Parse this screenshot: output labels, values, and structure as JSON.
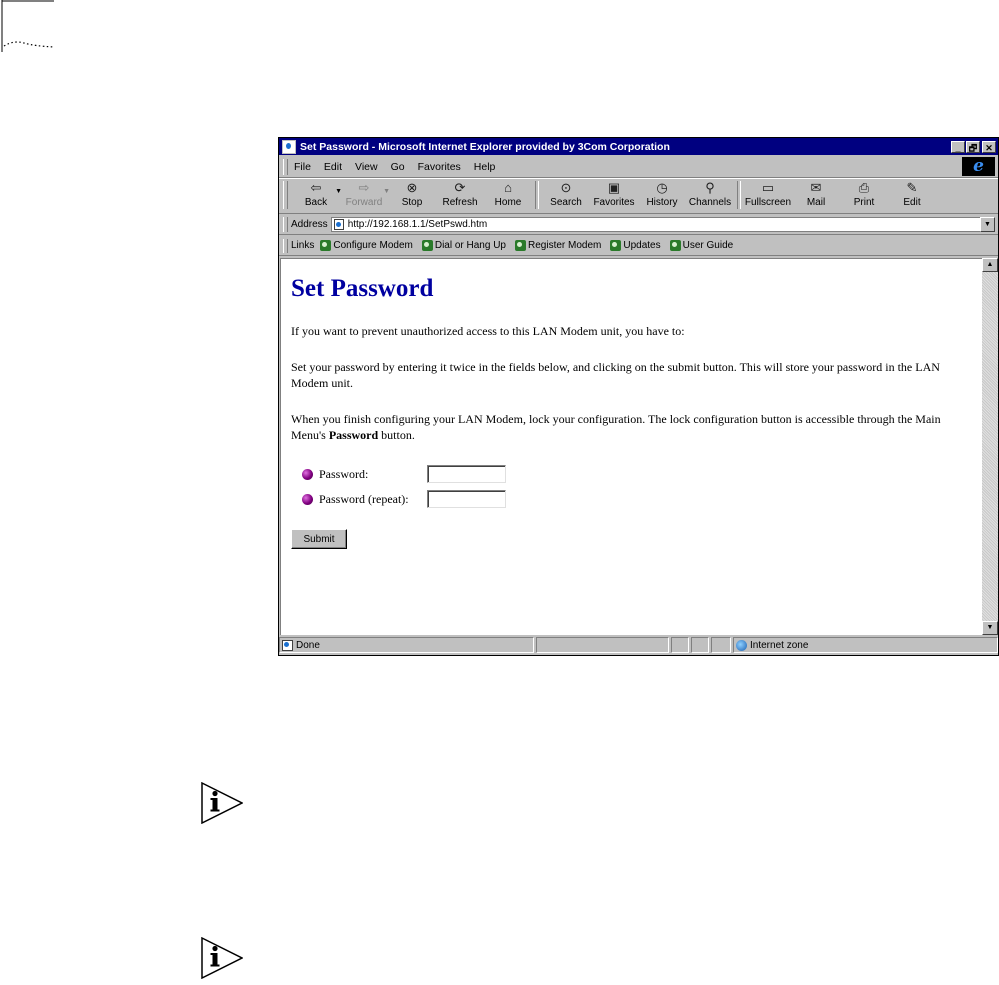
{
  "window": {
    "title": "Set Password - Microsoft Internet Explorer provided by 3Com Corporation",
    "buttons": {
      "minimize": "_",
      "restore": "🗗",
      "close": "✕"
    }
  },
  "menu": [
    {
      "label": "File"
    },
    {
      "label": "Edit"
    },
    {
      "label": "View"
    },
    {
      "label": "Go"
    },
    {
      "label": "Favorites"
    },
    {
      "label": "Help"
    }
  ],
  "toolbar": {
    "back": "Back",
    "forward": "Forward",
    "stop": "Stop",
    "refresh": "Refresh",
    "home": "Home",
    "search": "Search",
    "favorites": "Favorites",
    "history": "History",
    "channels": "Channels",
    "fullscreen": "Fullscreen",
    "mail": "Mail",
    "print": "Print",
    "edit": "Edit"
  },
  "address": {
    "label": "Address",
    "url": "http://192.168.1.1/SetPswd.htm"
  },
  "links": {
    "label": "Links",
    "items": [
      {
        "label": "Configure Modem"
      },
      {
        "label": "Dial or Hang Up"
      },
      {
        "label": "Register Modem"
      },
      {
        "label": "Updates"
      },
      {
        "label": "User Guide"
      }
    ]
  },
  "page": {
    "title": "Set Password",
    "para1": "If you want to prevent unauthorized access to this LAN Modem unit, you have to:",
    "para2": "Set your password by entering it twice in the fields below, and clicking on the submit button. This will store your password in the LAN Modem unit.",
    "para3_before": "When you finish configuring your LAN Modem, lock your configuration. The lock configuration button is accessible through the Main Menu's ",
    "para3_bold": "Password",
    "para3_after": " button.",
    "password_label": "Password:",
    "password_repeat_label": "Password (repeat):",
    "password_value": "",
    "password_repeat_value": "",
    "submit": "Submit"
  },
  "status": {
    "text": "Done",
    "zone": "Internet zone"
  },
  "icons": {
    "note": "info-note-icon",
    "ie_logo": "ie-logo-icon"
  },
  "colors": {
    "titlebar": "#000080",
    "page_title": "#0000a0",
    "chrome": "#c0c0c0"
  }
}
